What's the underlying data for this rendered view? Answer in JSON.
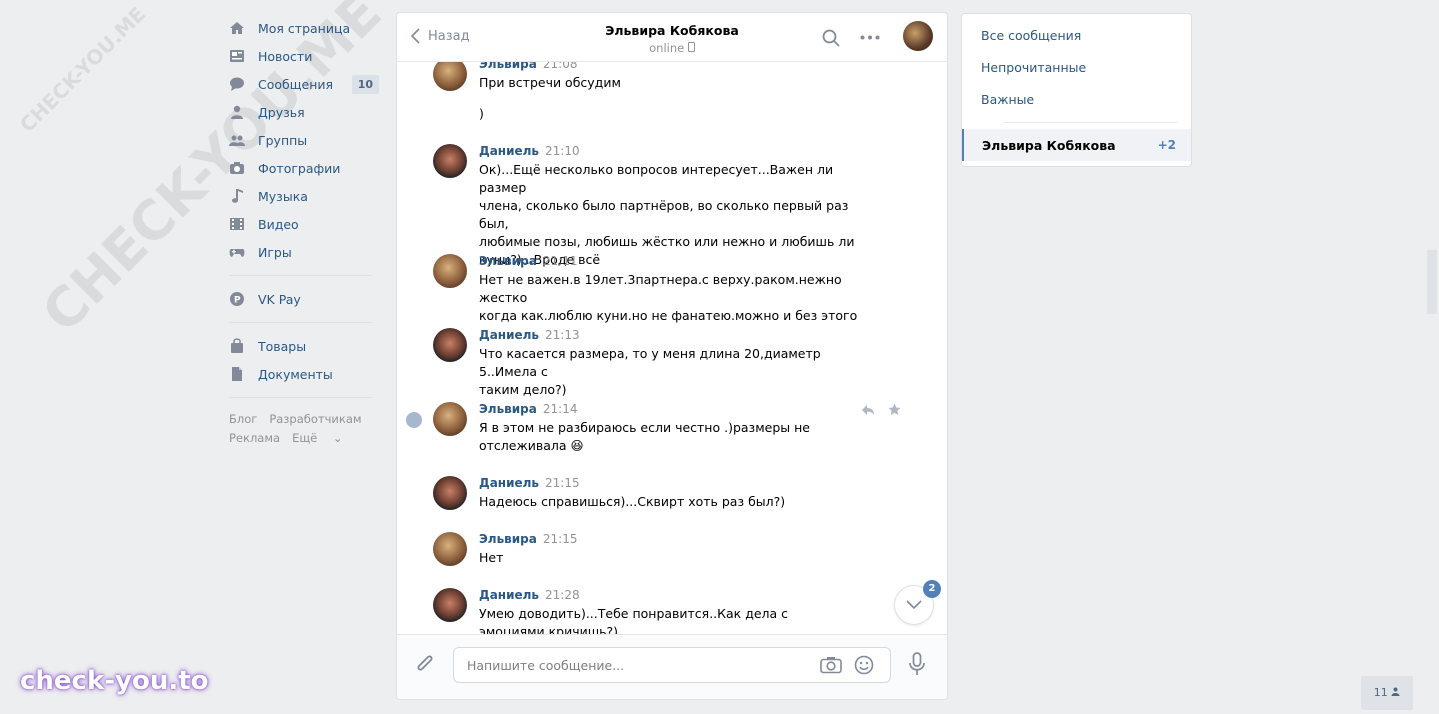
{
  "nav": {
    "items": [
      {
        "label": "Моя страница",
        "icon": "home-icon"
      },
      {
        "label": "Новости",
        "icon": "news-icon"
      },
      {
        "label": "Сообщения",
        "icon": "messages-icon",
        "badge": "10"
      },
      {
        "label": "Друзья",
        "icon": "friends-icon"
      },
      {
        "label": "Группы",
        "icon": "groups-icon"
      },
      {
        "label": "Фотографии",
        "icon": "camera-icon"
      },
      {
        "label": "Музыка",
        "icon": "music-icon"
      },
      {
        "label": "Видео",
        "icon": "video-icon"
      },
      {
        "label": "Игры",
        "icon": "gamepad-icon"
      }
    ],
    "vkpay": {
      "label": "VK Pay",
      "icon": "vkpay-icon"
    },
    "extra": [
      {
        "label": "Товары",
        "icon": "bag-icon"
      },
      {
        "label": "Документы",
        "icon": "document-icon"
      }
    ],
    "footer": {
      "blog": "Блог",
      "dev": "Разработчикам",
      "ads": "Реклама",
      "more": "Ещё"
    }
  },
  "chat": {
    "back_label": "Назад",
    "peer_name": "Эльвира Кобякова",
    "peer_status": "online",
    "messages": [
      {
        "author": "Эльвира",
        "time": "21:08",
        "lines": [
          "При встречи обсудим",
          "",
          ")"
        ]
      },
      {
        "author": "Даниель",
        "time": "21:10",
        "lines": [
          "Ок)...Ещё несколько вопросов интересует...Важен ли размер",
          "члена, сколько было партнёров, во сколько первый раз был,",
          "любимые позы, любишь жёстко или нежно и любишь ли",
          "куни?)...Вроде всё"
        ]
      },
      {
        "author": "Эльвира",
        "time": "21:11",
        "lines": [
          "Нет не важен.в 19лет.3партнера.с верху.раком.нежно жестко",
          "когда как.люблю куни.но не фанатею.можно и без этого"
        ]
      },
      {
        "author": "Даниель",
        "time": "21:13",
        "lines": [
          "Что касается размера, то у меня длина 20,диаметр 5..Имела с",
          "таким дело?)"
        ]
      },
      {
        "author": "Эльвира",
        "time": "21:14",
        "lines": [
          "Я в этом не разбираюсь если честно .)размеры не",
          "отслеживала 😆"
        ]
      },
      {
        "author": "Даниель",
        "time": "21:15",
        "lines": [
          "Надеюсь справишься)...Сквирт хоть раз был?)"
        ]
      },
      {
        "author": "Эльвира",
        "time": "21:15",
        "lines": [
          "Нет"
        ]
      },
      {
        "author": "Даниель",
        "time": "21:28",
        "lines": [
          "Умею доводить)...Тебе понравится..Как дела с",
          "эмоциями кричишь?)"
        ]
      }
    ],
    "unread_badge": "2",
    "composer_placeholder": "Напишите сообщение..."
  },
  "right": {
    "all": "Все сообщения",
    "unread": "Непрочитанные",
    "important": "Важные",
    "active_name": "Эльвира Кобякова",
    "active_count": "+2"
  },
  "watermark": {
    "diag": "CHECK-YOU.ME",
    "logo": "check-you.to"
  },
  "bottom_counter": "11"
}
